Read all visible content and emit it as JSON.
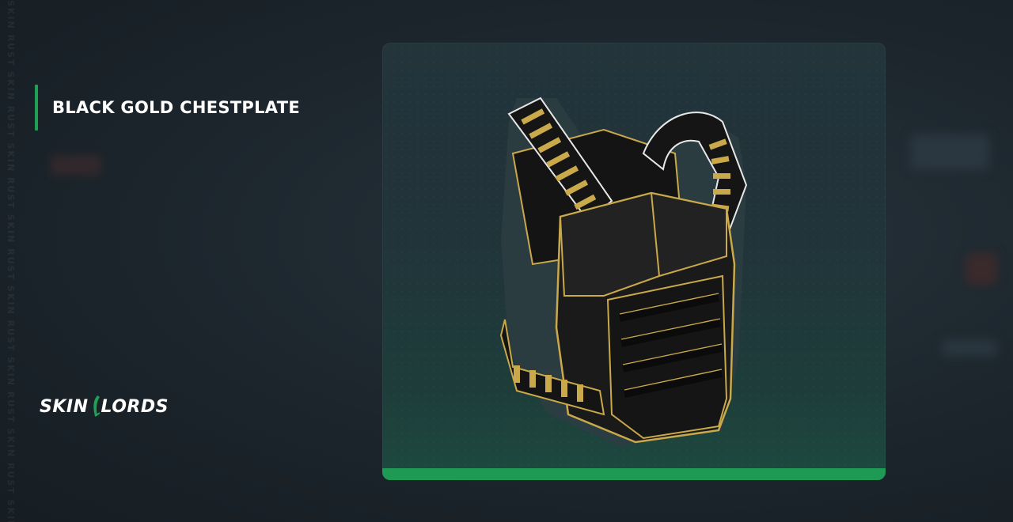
{
  "item": {
    "title": "BLACK GOLD CHESTPLATE",
    "image_icon": "chestplate-image"
  },
  "watermark": {
    "text": "SKIN RUST SKIN RUST SKIN RUST SKIN RUST SKIN RUST SKIN RUST SKIN RUST SKIN RUST"
  },
  "brand": {
    "name_left": "SKIN",
    "name_right": "LORDS",
    "logo_icon": "skinlords-logo-icon"
  },
  "colors": {
    "accent": "#1fa155",
    "card_bottom": "#1f9a55",
    "background": "#1b232a",
    "gold": "#c9a94a"
  }
}
